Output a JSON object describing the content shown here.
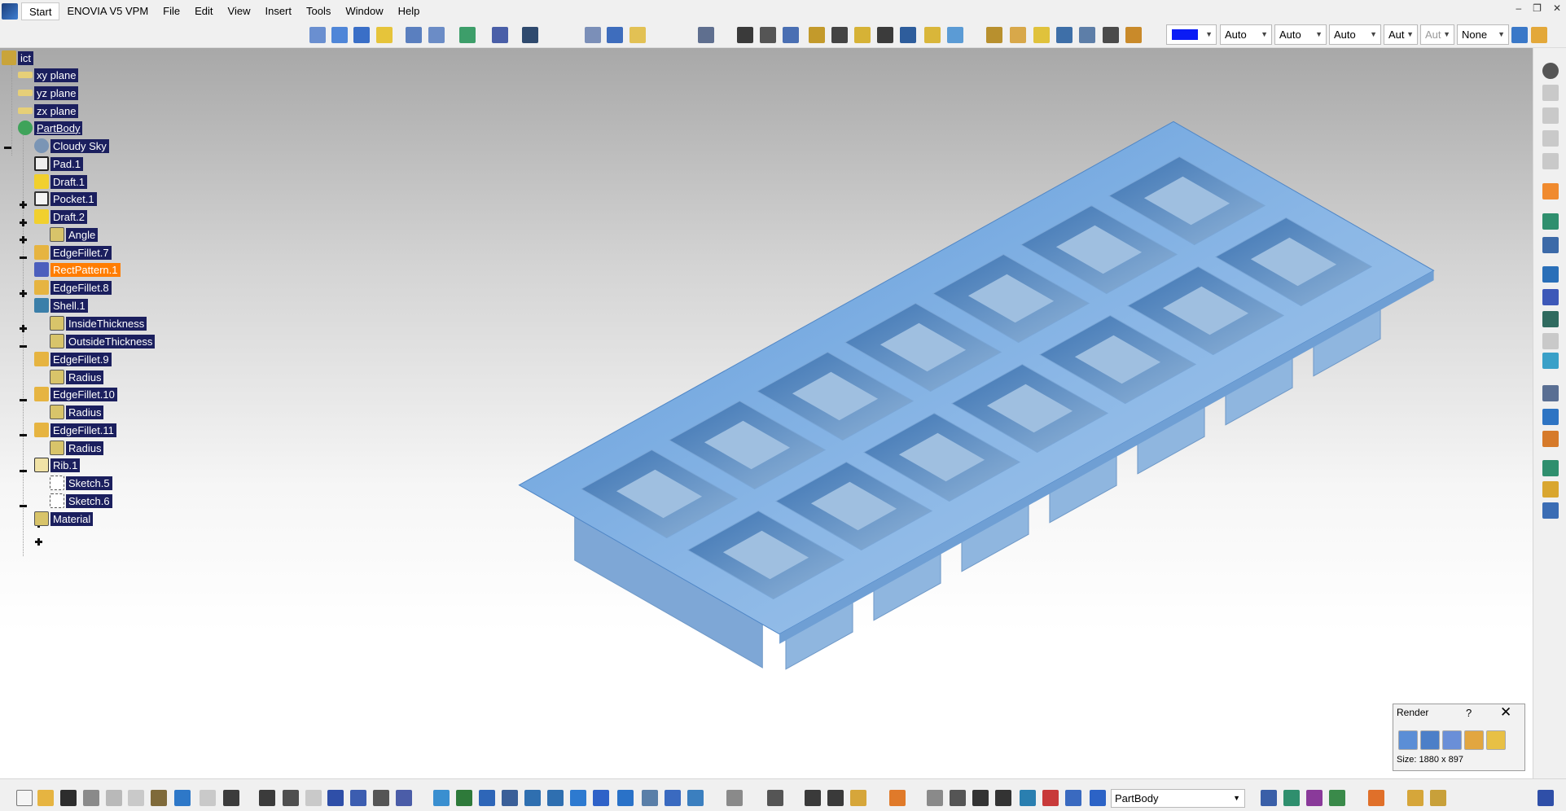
{
  "menubar": {
    "items": [
      {
        "id": "start",
        "label": "Start"
      },
      {
        "id": "enovia",
        "label": "ENOVIA V5 VPM"
      },
      {
        "id": "file",
        "label": "File"
      },
      {
        "id": "edit",
        "label": "Edit"
      },
      {
        "id": "view",
        "label": "View"
      },
      {
        "id": "insert",
        "label": "Insert"
      },
      {
        "id": "tools",
        "label": "Tools"
      },
      {
        "id": "window",
        "label": "Window"
      },
      {
        "id": "help",
        "label": "Help"
      }
    ]
  },
  "graphic_properties": {
    "color_hex": "#0a1bf5",
    "transparency": "Auto",
    "line_thickness": "Auto",
    "line_type": "Auto",
    "point_type": "Aut",
    "layer_type": "Aut",
    "layer": "None"
  },
  "tree": {
    "root_label": "ict",
    "items": [
      {
        "label": "xy plane",
        "icon": "plane-icon"
      },
      {
        "label": "yz plane",
        "icon": "plane-icon"
      },
      {
        "label": "zx plane",
        "icon": "plane-icon"
      },
      {
        "label": "PartBody",
        "icon": "partbody-gear-icon"
      },
      {
        "label": "Cloudy Sky",
        "icon": "environment-sphere-icon"
      },
      {
        "label": "Pad.1",
        "icon": "pad-icon"
      },
      {
        "label": "Draft.1",
        "icon": "draft-icon"
      },
      {
        "label": "Pocket.1",
        "icon": "pocket-icon"
      },
      {
        "label": "Draft.2",
        "icon": "draft-icon"
      },
      {
        "label": "Angle",
        "icon": "parameter-icon"
      },
      {
        "label": "EdgeFillet.7",
        "icon": "edge-fillet-icon"
      },
      {
        "label": "RectPattern.1",
        "icon": "rect-pattern-icon"
      },
      {
        "label": "EdgeFillet.8",
        "icon": "edge-fillet-icon"
      },
      {
        "label": "Shell.1",
        "icon": "shell-icon"
      },
      {
        "label": "InsideThickness",
        "icon": "parameter-icon"
      },
      {
        "label": "OutsideThickness",
        "icon": "parameter-icon"
      },
      {
        "label": "EdgeFillet.9",
        "icon": "edge-fillet-icon"
      },
      {
        "label": "Radius",
        "icon": "parameter-icon"
      },
      {
        "label": "EdgeFillet.10",
        "icon": "edge-fillet-icon"
      },
      {
        "label": "Radius",
        "icon": "parameter-icon"
      },
      {
        "label": "EdgeFillet.11",
        "icon": "edge-fillet-icon"
      },
      {
        "label": "Radius",
        "icon": "parameter-icon"
      },
      {
        "label": "Rib.1",
        "icon": "rib-icon"
      },
      {
        "label": "Sketch.5",
        "icon": "sketch-icon"
      },
      {
        "label": "Sketch.6",
        "icon": "sketch-icon"
      },
      {
        "label": "Material",
        "icon": "material-icon"
      }
    ]
  },
  "render_panel": {
    "title": "Render",
    "help": "?",
    "close": "✕",
    "size_text": "Size: 1880 x 897"
  },
  "bottom": {
    "current_body": "PartBody"
  }
}
